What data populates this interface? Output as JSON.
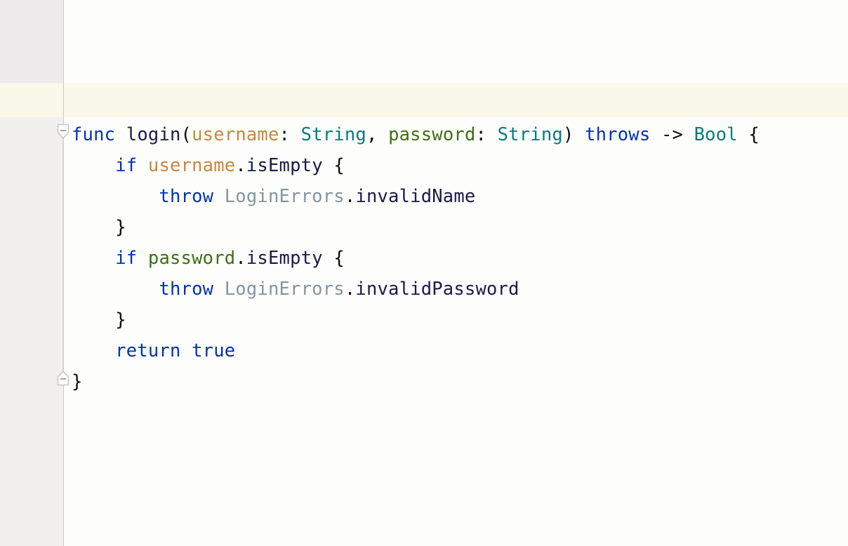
{
  "editor": {
    "language": "Swift",
    "background_color": "#fdfdfb",
    "gutter_color": "#f1f0ee",
    "gutter_border_color": "#c9c9c7",
    "current_line_highlight_color": "#faf9e9",
    "fold_line_color": "#d3d3d1"
  },
  "syntax_colors": {
    "keyword": "#0033b3",
    "plain": "#1b1b4a",
    "punctuation": "#0c0c0c",
    "parameter_username": "#c8873c",
    "parameter_password": "#3b7010",
    "type": "#0a7b7b",
    "enum_type": "#8295a0",
    "member": "#1b1b4a"
  },
  "fold_markers": [
    {
      "name": "fold-collapse-open",
      "glyph": "minus",
      "state": "expanded",
      "direction": "down"
    },
    {
      "name": "fold-collapse-close",
      "glyph": "minus",
      "state": "expanded",
      "direction": "up"
    }
  ],
  "code": {
    "lines": [
      {
        "indent": "",
        "tokens": [
          {
            "text": "func",
            "type": "keyword"
          },
          {
            "text": " ",
            "type": "plain"
          },
          {
            "text": "login",
            "type": "plain"
          },
          {
            "text": "(",
            "type": "punctuation"
          },
          {
            "text": "username",
            "type": "parameter_username"
          },
          {
            "text": ": ",
            "type": "punctuation"
          },
          {
            "text": "String",
            "type": "type"
          },
          {
            "text": ", ",
            "type": "punctuation"
          },
          {
            "text": "password",
            "type": "parameter_password"
          },
          {
            "text": ": ",
            "type": "punctuation"
          },
          {
            "text": "String",
            "type": "type"
          },
          {
            "text": ")",
            "type": "punctuation"
          },
          {
            "text": " ",
            "type": "plain"
          },
          {
            "text": "throws",
            "type": "keyword"
          },
          {
            "text": " ",
            "type": "plain"
          },
          {
            "text": "->",
            "type": "punctuation"
          },
          {
            "text": " ",
            "type": "plain"
          },
          {
            "text": "Bool",
            "type": "type"
          },
          {
            "text": " ",
            "type": "plain"
          },
          {
            "text": "{",
            "type": "punctuation"
          }
        ]
      },
      {
        "indent": "    ",
        "tokens": [
          {
            "text": "if",
            "type": "keyword"
          },
          {
            "text": " ",
            "type": "plain"
          },
          {
            "text": "username",
            "type": "parameter_username"
          },
          {
            "text": ".",
            "type": "punctuation"
          },
          {
            "text": "isEmpty",
            "type": "member"
          },
          {
            "text": " ",
            "type": "plain"
          },
          {
            "text": "{",
            "type": "punctuation"
          }
        ]
      },
      {
        "indent": "        ",
        "tokens": [
          {
            "text": "throw",
            "type": "keyword"
          },
          {
            "text": " ",
            "type": "plain"
          },
          {
            "text": "LoginErrors",
            "type": "enum_type"
          },
          {
            "text": ".",
            "type": "punctuation"
          },
          {
            "text": "invalidName",
            "type": "member"
          }
        ]
      },
      {
        "indent": "    ",
        "tokens": [
          {
            "text": "}",
            "type": "punctuation"
          }
        ]
      },
      {
        "indent": "    ",
        "tokens": [
          {
            "text": "if",
            "type": "keyword"
          },
          {
            "text": " ",
            "type": "plain"
          },
          {
            "text": "password",
            "type": "parameter_password"
          },
          {
            "text": ".",
            "type": "punctuation"
          },
          {
            "text": "isEmpty",
            "type": "member"
          },
          {
            "text": " ",
            "type": "plain"
          },
          {
            "text": "{",
            "type": "punctuation"
          }
        ]
      },
      {
        "indent": "        ",
        "tokens": [
          {
            "text": "throw",
            "type": "keyword"
          },
          {
            "text": " ",
            "type": "plain"
          },
          {
            "text": "LoginErrors",
            "type": "enum_type"
          },
          {
            "text": ".",
            "type": "punctuation"
          },
          {
            "text": "invalidPassword",
            "type": "member"
          }
        ]
      },
      {
        "indent": "    ",
        "tokens": [
          {
            "text": "}",
            "type": "punctuation"
          }
        ]
      },
      {
        "indent": "    ",
        "tokens": [
          {
            "text": "return",
            "type": "keyword"
          },
          {
            "text": " ",
            "type": "plain"
          },
          {
            "text": "true",
            "type": "keyword"
          }
        ]
      },
      {
        "indent": "",
        "tokens": [
          {
            "text": "}",
            "type": "punctuation"
          }
        ]
      }
    ]
  }
}
